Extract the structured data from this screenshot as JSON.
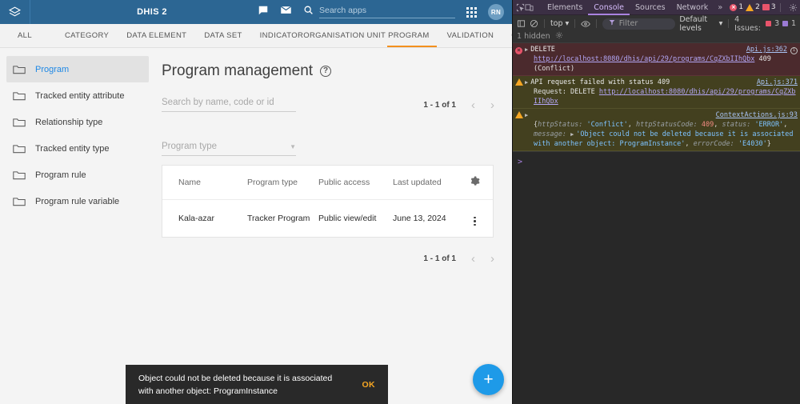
{
  "dhis": {
    "header": {
      "logo_icon": "dhis2-layers-logo",
      "title": "DHIS 2",
      "message_icon": "chat-bubble-icon",
      "mail_icon": "envelope-icon",
      "search_icon": "search-icon",
      "search_placeholder": "Search apps",
      "apps_icon": "apps-grid-icon",
      "avatar_initials": "RN",
      "bg_color": "#2c6693"
    },
    "tabs": {
      "active_index": 6,
      "accent_color": "#f3901d",
      "items": [
        {
          "label": "ALL"
        },
        {
          "label": "CATEGORY"
        },
        {
          "label": "DATA ELEMENT"
        },
        {
          "label": "DATA SET"
        },
        {
          "label": "INDICATOR"
        },
        {
          "label": "ORGANISATION UNIT"
        },
        {
          "label": "PROGRAM"
        },
        {
          "label": "VALIDATION"
        },
        {
          "label": "OTHER"
        }
      ],
      "extra_icon": "crop-transform-icon"
    },
    "sidebar": {
      "items": [
        {
          "label": "Program",
          "icon": "folder-icon",
          "active": true
        },
        {
          "label": "Tracked entity attribute",
          "icon": "folder-icon",
          "active": false
        },
        {
          "label": "Relationship type",
          "icon": "folder-icon",
          "active": false
        },
        {
          "label": "Tracked entity type",
          "icon": "folder-icon",
          "active": false
        },
        {
          "label": "Program rule",
          "icon": "folder-icon",
          "active": false
        },
        {
          "label": "Program rule variable",
          "icon": "folder-icon",
          "active": false
        }
      ]
    },
    "main": {
      "page_title": "Program management",
      "help_icon": "help-question-icon",
      "search_placeholder": "Search by name, code or id",
      "search_value": "",
      "program_type_label": "Program type",
      "program_type_value": "",
      "pager_top": "1 - 1 of 1",
      "pager_bottom": "1 - 1 of 1",
      "prev_icon": "chevron-left-icon",
      "next_icon": "chevron-right-icon",
      "table": {
        "columns": [
          "Name",
          "Program type",
          "Public access",
          "Last updated"
        ],
        "settings_icon": "gear-icon",
        "rows": [
          {
            "name": "Kala-azar",
            "program_type": "Tracker Program",
            "public_access": "Public view/edit",
            "last_updated": "June 13, 2024",
            "actions_icon": "kebab-menu-icon"
          }
        ]
      },
      "fab_label": "+",
      "fab_icon": "plus-icon",
      "fab_color": "#1e9ae8"
    },
    "snackbar": {
      "message_line1": "Object could not be deleted because it is associated",
      "message_line2": "with another object: ProgramInstance",
      "action_label": "OK",
      "action_color": "#f5a623"
    }
  },
  "devtools": {
    "toolbar": {
      "inspect_icon": "inspect-element-icon",
      "device_icon": "device-toolbar-icon",
      "tabs": [
        {
          "label": "Elements",
          "active": false
        },
        {
          "label": "Console",
          "active": true
        },
        {
          "label": "Sources",
          "active": false
        },
        {
          "label": "Network",
          "active": false
        }
      ],
      "more_tabs_icon": "chevron-double-right-icon",
      "error_count": "1",
      "warning_count": "2",
      "message_count": "3",
      "settings_icon": "gear-icon",
      "kebab_icon": "kebab-menu-icon",
      "close_icon": "close-icon",
      "bg_color": "#3b2f44",
      "active_tab_color": "#d6bcfa"
    },
    "filterbar": {
      "sidebar_toggle_icon": "console-sidebar-icon",
      "clear_icon": "clear-console-icon",
      "context_label": "top",
      "context_caret": "▾",
      "eye_icon": "live-expression-icon",
      "filter_icon": "filter-funnel-icon",
      "filter_placeholder": "Filter",
      "filter_value": "",
      "levels_label": "Default levels",
      "levels_caret": "▾",
      "issues_label": "4 Issues:",
      "issues_error_count": "3",
      "issues_info_count": "1",
      "hidden_label": "1 hidden",
      "hidden_settings_icon": "gear-icon"
    },
    "console_messages": [
      {
        "severity": "error",
        "icon": "error-circle-icon",
        "expand_icon": "triangle-right-icon",
        "label": "DELETE",
        "source": "Api.js:362",
        "badge": "info-circle-icon",
        "url": "http://localhost:8080/dhis/api/29/programs/CqZXbIIhQbx",
        "status": "409 (Conflict)"
      },
      {
        "severity": "warn",
        "icon": "warning-triangle-icon",
        "expand_icon": "triangle-right-icon",
        "label": "API request failed with status 409",
        "source": "Api.js:371",
        "prefix": "Request: DELETE ",
        "url": "http://localhost:8080/dhis/api/29/programs/CqZXbIIhQbx"
      },
      {
        "severity": "warn",
        "icon": "warning-triangle-icon",
        "expand_icon": "triangle-right-icon",
        "label": "",
        "source": "ContextActions.js:93",
        "object": {
          "open_brace": "{",
          "entries": [
            {
              "key": "httpStatus:",
              "value": "'Conflict'",
              "type": "string",
              "trail": ","
            },
            {
              "key": "httpStatusCode:",
              "value": "409",
              "type": "number",
              "trail": ","
            },
            {
              "key": "status:",
              "value": "'ERROR'",
              "type": "string",
              "trail": ","
            },
            {
              "key": "message:",
              "value": "'Object could not be deleted because it is associated with another object: ProgramInstance'",
              "type": "string",
              "trail": ","
            },
            {
              "key": "errorCode:",
              "value": "'E4030'",
              "type": "string",
              "trail": ""
            }
          ],
          "close_brace": "}"
        }
      }
    ],
    "prompt": ">"
  }
}
